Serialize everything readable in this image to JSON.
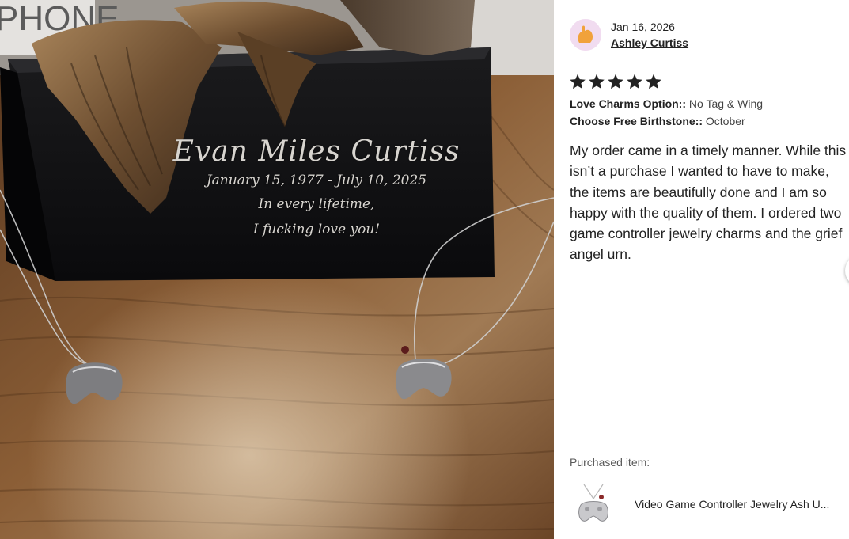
{
  "photo": {
    "engraving": {
      "name": "Evan Miles Curtiss",
      "dates": "January 15, 1977 - July 10, 2025",
      "line1": "In every lifetime,",
      "line2": "I fucking love you!"
    },
    "background_text": "PHONE"
  },
  "review": {
    "date": "Jan 16, 2026",
    "reviewer": "Ashley Curtiss",
    "rating": 5,
    "options": [
      {
        "label": "Love Charms Option::",
        "value": "No Tag & Wing"
      },
      {
        "label": "Choose Free Birthstone::",
        "value": "October"
      }
    ],
    "text": "My order came in a timely manner. While this isn’t a purchase I wanted to have to make, the items are beautifully done and I am so happy with the quality of them. I ordered two game controller jewelry charms and the grief angel urn."
  },
  "purchased": {
    "label": "Purchased item:",
    "title": "Video Game Controller Jewelry Ash U..."
  },
  "colors": {
    "avatar_bg": "#f1dcf0",
    "avatar_fg": "#f1a23b",
    "star": "#222222",
    "text": "#222222"
  },
  "icons": {
    "avatar": "orange-hand-avatar-icon",
    "star": "star-icon"
  }
}
